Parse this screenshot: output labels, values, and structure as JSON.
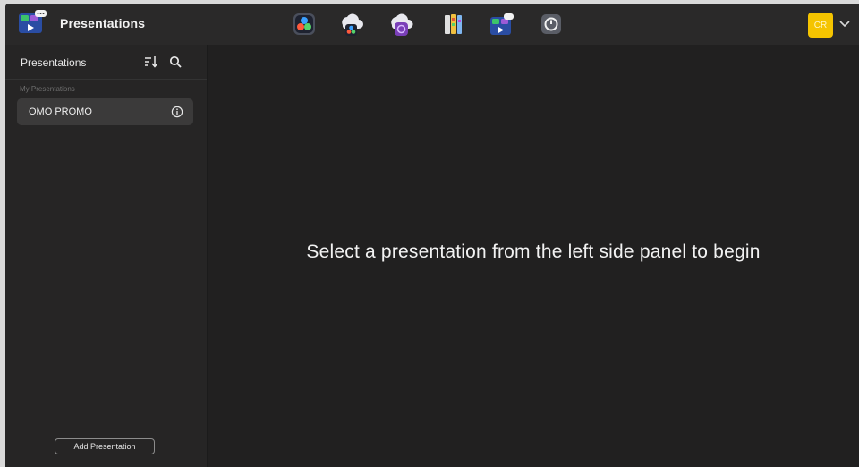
{
  "header": {
    "title": "Presentations",
    "app_icon": "presentations-app-icon",
    "launchers": [
      {
        "name": "davinci-resolve-icon"
      },
      {
        "name": "cloud-resolve-icon"
      },
      {
        "name": "cloud-store-icon"
      },
      {
        "name": "media-library-icon"
      },
      {
        "name": "presentations-launcher-icon"
      },
      {
        "name": "settings-dial-icon"
      }
    ],
    "avatar_initials": "CR",
    "avatar_color": "#f5c400"
  },
  "sidebar": {
    "title": "Presentations",
    "section_label": "My Presentations",
    "items": [
      {
        "label": "OMO PROMO",
        "selected": true
      }
    ],
    "add_button_label": "Add Presentation"
  },
  "main": {
    "empty_message": "Select a presentation from the left side panel to begin"
  }
}
